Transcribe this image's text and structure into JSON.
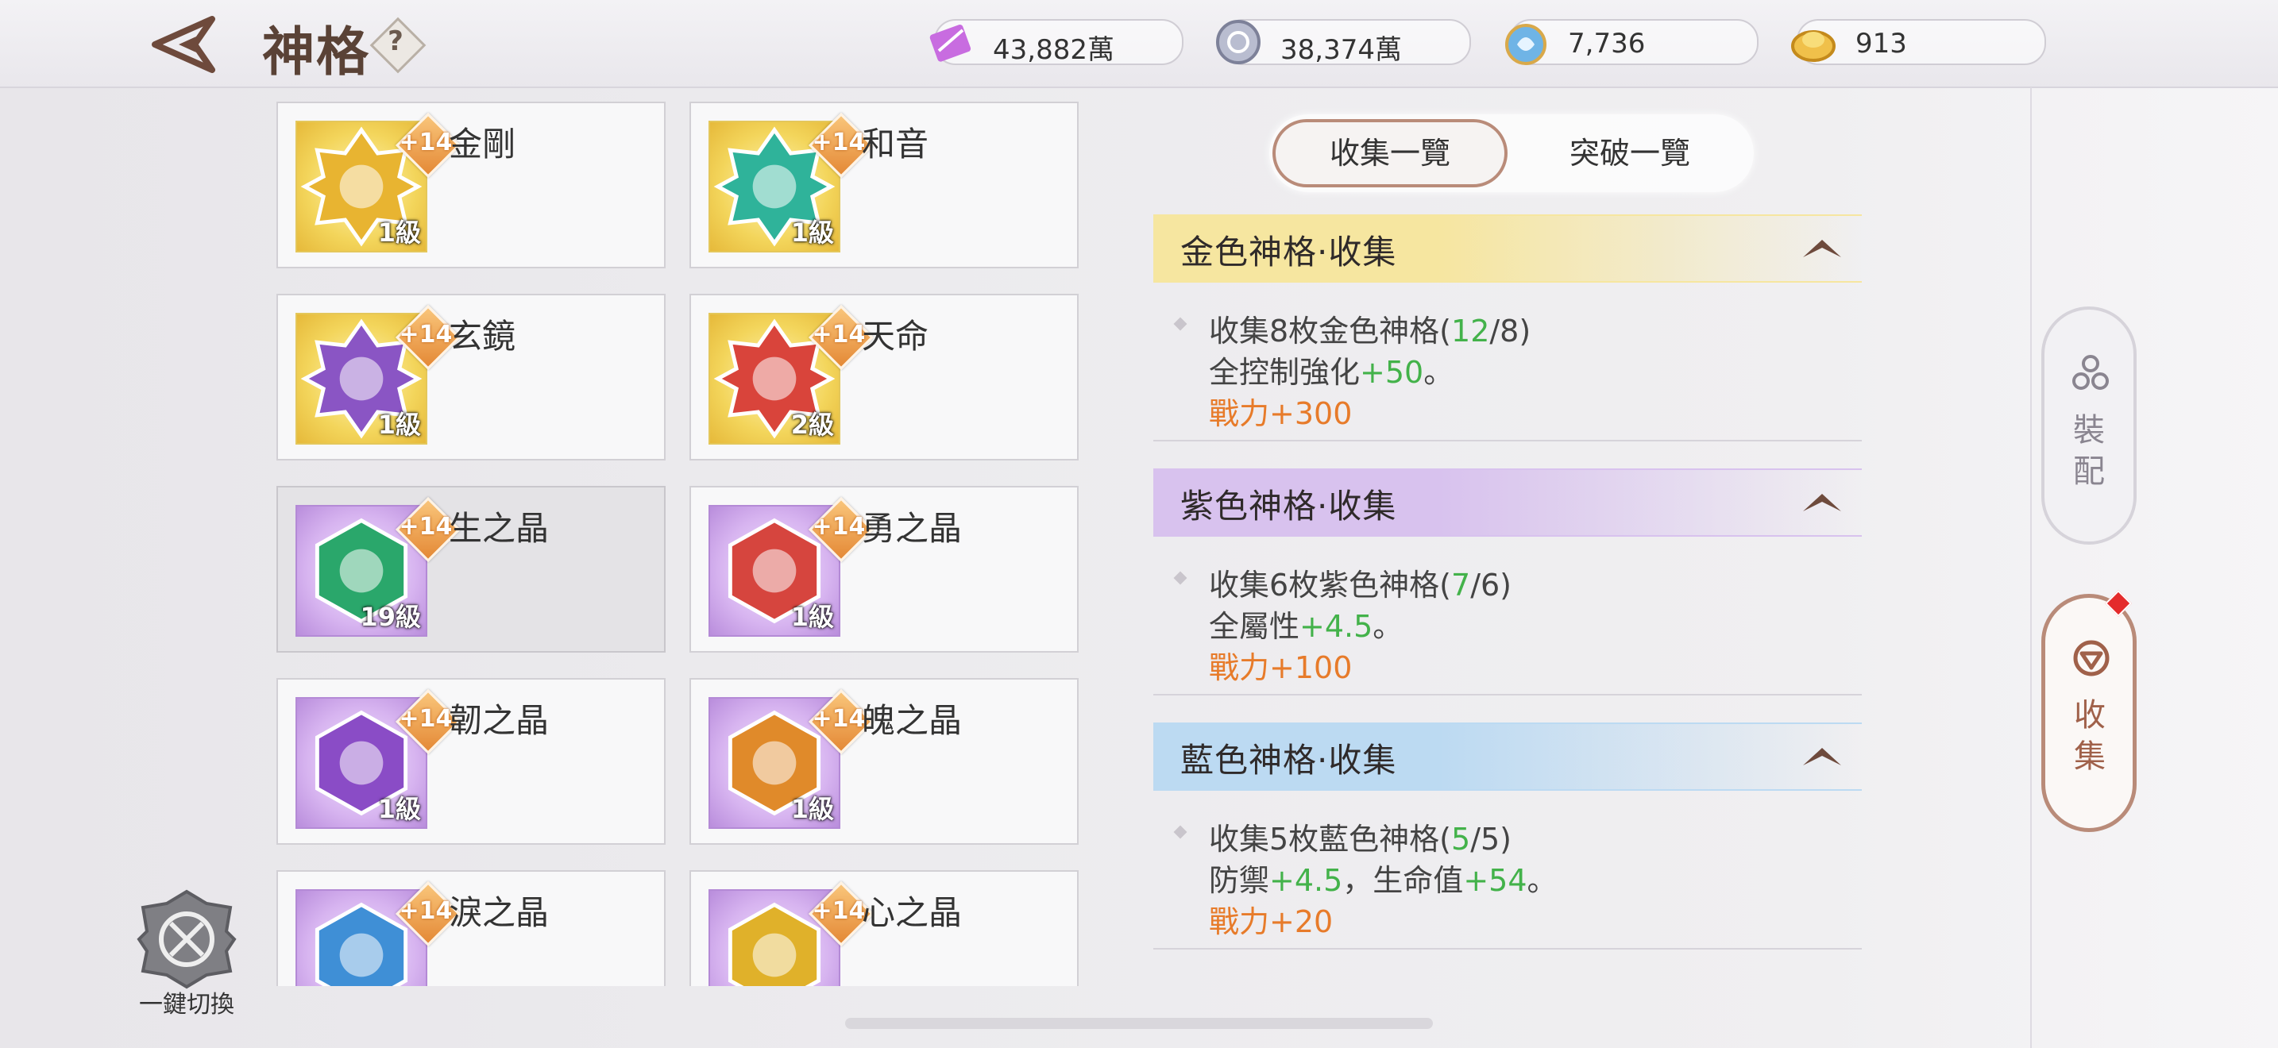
{
  "header": {
    "title": "神格",
    "help_label": "?",
    "currencies": [
      {
        "icon": "feather-scroll-icon",
        "value": "43,882萬"
      },
      {
        "icon": "silver-coin-icon",
        "value": "38,374萬"
      },
      {
        "icon": "blue-orb-icon",
        "value": "7,736"
      },
      {
        "icon": "gold-ingot-icon",
        "value": "913"
      }
    ]
  },
  "cards": [
    {
      "name": "金剛",
      "level": "1級",
      "plus": "+14",
      "tier": "gold",
      "color": "#e8b431",
      "symbol": "turtle-icon"
    },
    {
      "name": "和音",
      "level": "1級",
      "plus": "+14",
      "tier": "gold",
      "color": "#2fb39a",
      "symbol": "harp-icon"
    },
    {
      "name": "玄鏡",
      "level": "1級",
      "plus": "+14",
      "tier": "gold",
      "color": "#8a55c4",
      "symbol": "mirror-icon"
    },
    {
      "name": "天命",
      "level": "2級",
      "plus": "+14",
      "tier": "gold",
      "color": "#d9443b",
      "symbol": "crossed-swords-icon"
    },
    {
      "name": "生之晶",
      "level": "19級",
      "plus": "+14",
      "tier": "purple",
      "color": "#2aa76b",
      "symbol": "sprout-icon"
    },
    {
      "name": "勇之晶",
      "level": "1級",
      "plus": "+14",
      "tier": "purple",
      "color": "#d6453e",
      "symbol": "wolf-icon"
    },
    {
      "name": "韌之晶",
      "level": "1級",
      "plus": "+14",
      "tier": "purple",
      "color": "#8a4cc6",
      "symbol": "vase-icon"
    },
    {
      "name": "魄之晶",
      "level": "1級",
      "plus": "+14",
      "tier": "purple",
      "color": "#e08a2a",
      "symbol": "arrow-up-icon"
    },
    {
      "name": "淚之晶",
      "level": "",
      "plus": "+14",
      "tier": "purple",
      "color": "#3f8fd6",
      "symbol": "drop-icon"
    },
    {
      "name": "心之晶",
      "level": "",
      "plus": "+14",
      "tier": "purple",
      "color": "#e0b12a",
      "symbol": "feather-icon"
    }
  ],
  "tabs": {
    "collect": "收集一覽",
    "breakthrough": "突破一覽"
  },
  "sections": [
    {
      "title": "金色神格·收集",
      "req_prefix": "收集8枚金色神格(",
      "have": "12",
      "need": "/8)",
      "stat_label": "全控制強化",
      "stat_value": "+50",
      "stat_suffix": "。",
      "stat2_label": "",
      "stat2_value": "",
      "power": "戰力+300",
      "color": "#f6e6a0"
    },
    {
      "title": "紫色神格·收集",
      "req_prefix": "收集6枚紫色神格(",
      "have": "7",
      "need": "/6)",
      "stat_label": "全屬性",
      "stat_value": "+4.5",
      "stat_suffix": "。",
      "stat2_label": "",
      "stat2_value": "",
      "power": "戰力+100",
      "color": "#d8c2ee"
    },
    {
      "title": "藍色神格·收集",
      "req_prefix": "收集5枚藍色神格(",
      "have": "5",
      "need": "/5)",
      "stat_label": "防禦",
      "stat_value": "+4.5",
      "stat_suffix": "，生命值",
      "stat2_label": "",
      "stat2_value": "+54",
      "power": "戰力+20",
      "color": "#bcdaf2"
    }
  ],
  "side_nav": {
    "equip": "裝配",
    "collect": "收集"
  },
  "bottom": {
    "switch_label": "一鍵切換"
  }
}
